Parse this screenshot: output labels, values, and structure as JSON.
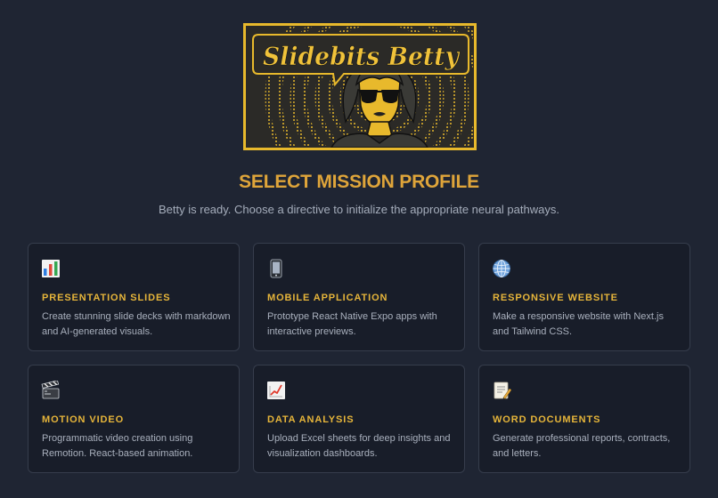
{
  "logo": {
    "text": "Slidebits Betty",
    "colors": {
      "frame": "#e8b92c",
      "background": "#2a2a28"
    }
  },
  "heading": "SELECT MISSION PROFILE",
  "subtitle": "Betty is ready. Choose a directive to initialize the appropriate neural pathways.",
  "colors": {
    "background": "#1f2533",
    "card_background": "#181d29",
    "card_border": "#363d4c",
    "accent": "#e6b53a",
    "heading": "#dfa53a",
    "muted_text": "#a9b0bd"
  },
  "cards": [
    {
      "icon": "bar-chart-icon",
      "title": "PRESENTATION SLIDES",
      "description": "Create stunning slide decks with markdown and AI-generated visuals."
    },
    {
      "icon": "mobile-phone-icon",
      "title": "MOBILE APPLICATION",
      "description": "Prototype React Native Expo apps with interactive previews."
    },
    {
      "icon": "globe-icon",
      "title": "RESPONSIVE WEBSITE",
      "description": "Make a responsive website with Next.js and Tailwind CSS."
    },
    {
      "icon": "clapper-board-icon",
      "title": "MOTION VIDEO",
      "description": "Programmatic video creation using Remotion. React-based animation."
    },
    {
      "icon": "trend-chart-icon",
      "title": "DATA ANALYSIS",
      "description": "Upload Excel sheets for deep insights and visualization dashboards."
    },
    {
      "icon": "memo-icon",
      "title": "WORD DOCUMENTS",
      "description": "Generate professional reports, contracts, and letters."
    }
  ]
}
